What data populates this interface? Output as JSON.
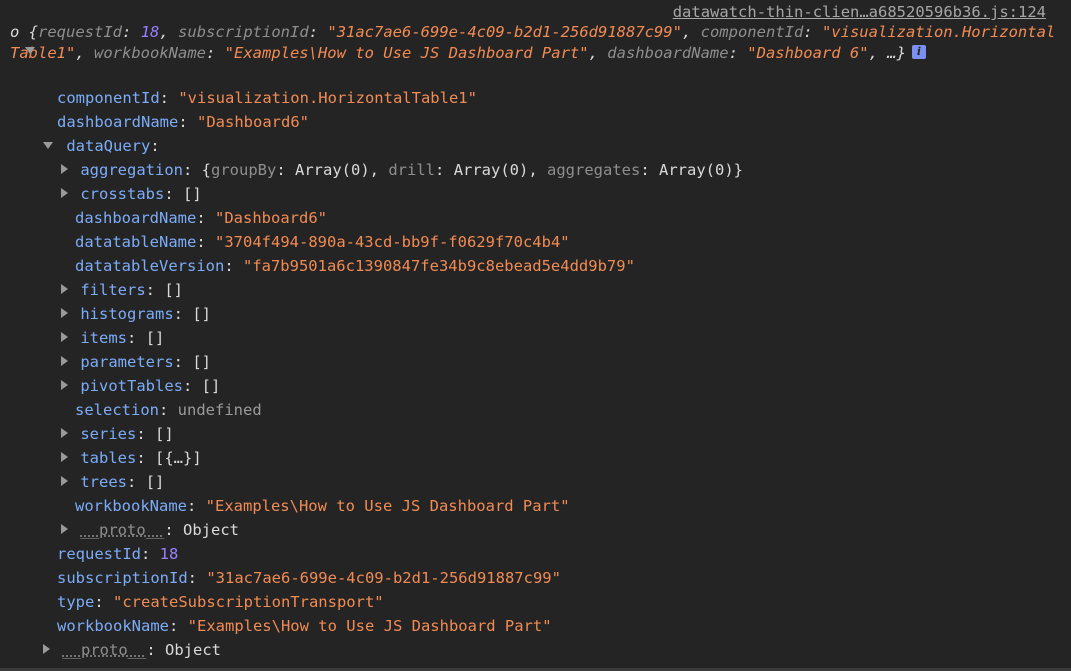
{
  "source_link": "datawatch-thin-clien…a68520596b36.js:124",
  "summary": {
    "prefix": "o ",
    "open_brace": "{",
    "k1": "requestId",
    "v1": "18",
    "k2": "subscriptionId",
    "v2": "\"31ac7ae6-699e-4c09-b2d1-256d91887c99\"",
    "k3": "componentId",
    "v3": "\"visualization.HorizontalTable1\"",
    "k4": "workbookName",
    "v4": "\"Examples\\How to Use JS Dashboard Part\"",
    "k5": "dashboardName",
    "v5": "\"Dashboard 6\"",
    "tail": ", …}",
    "info_icon": "i"
  },
  "props": {
    "componentId": {
      "key": "componentId",
      "value": "\"visualization.HorizontalTable1\""
    },
    "dashboardName": {
      "key": "dashboardName",
      "value": "\"Dashboard6\""
    },
    "dataQuery": {
      "key": "dataQuery",
      "value": ""
    },
    "aggregation": {
      "key": "aggregation",
      "open": "{",
      "k1": "groupBy",
      "v1": "Array(0)",
      "k2": "drill",
      "v2": "Array(0)",
      "k3": "aggregates",
      "v3": "Array(0)",
      "close": "}"
    },
    "crosstabs": {
      "key": "crosstabs",
      "value": "[]"
    },
    "dq_dashboardName": {
      "key": "dashboardName",
      "value": "\"Dashboard6\""
    },
    "datatableName": {
      "key": "datatableName",
      "value": "\"3704f494-890a-43cd-bb9f-f0629f70c4b4\""
    },
    "datatableVersion": {
      "key": "datatableVersion",
      "value": "\"fa7b9501a6c1390847fe34b9c8ebead5e4dd9b79\""
    },
    "filters": {
      "key": "filters",
      "value": "[]"
    },
    "histograms": {
      "key": "histograms",
      "value": "[]"
    },
    "items": {
      "key": "items",
      "value": "[]"
    },
    "parameters": {
      "key": "parameters",
      "value": "[]"
    },
    "pivotTables": {
      "key": "pivotTables",
      "value": "[]"
    },
    "selection": {
      "key": "selection",
      "value": "undefined"
    },
    "series": {
      "key": "series",
      "value": "[]"
    },
    "tables": {
      "key": "tables",
      "value": "[{…}]"
    },
    "trees": {
      "key": "trees",
      "value": "[]"
    },
    "dq_workbookName": {
      "key": "workbookName",
      "value": "\"Examples\\How to Use JS Dashboard Part\""
    },
    "dq_proto": {
      "key": "__proto__",
      "value": "Object"
    },
    "requestId": {
      "key": "requestId",
      "value": "18"
    },
    "subscriptionId": {
      "key": "subscriptionId",
      "value": "\"31ac7ae6-699e-4c09-b2d1-256d91887c99\""
    },
    "type": {
      "key": "type",
      "value": "\"createSubscriptionTransport\""
    },
    "workbookName": {
      "key": "workbookName",
      "value": "\"Examples\\How to Use JS Dashboard Part\""
    },
    "proto": {
      "key": "__proto__",
      "value": "Object"
    }
  },
  "colors": {
    "background": "#242424",
    "key": "#7cacf8",
    "string": "#f28b54",
    "number": "#9980ff",
    "text": "#dadada",
    "link": "#a6a6a6"
  }
}
